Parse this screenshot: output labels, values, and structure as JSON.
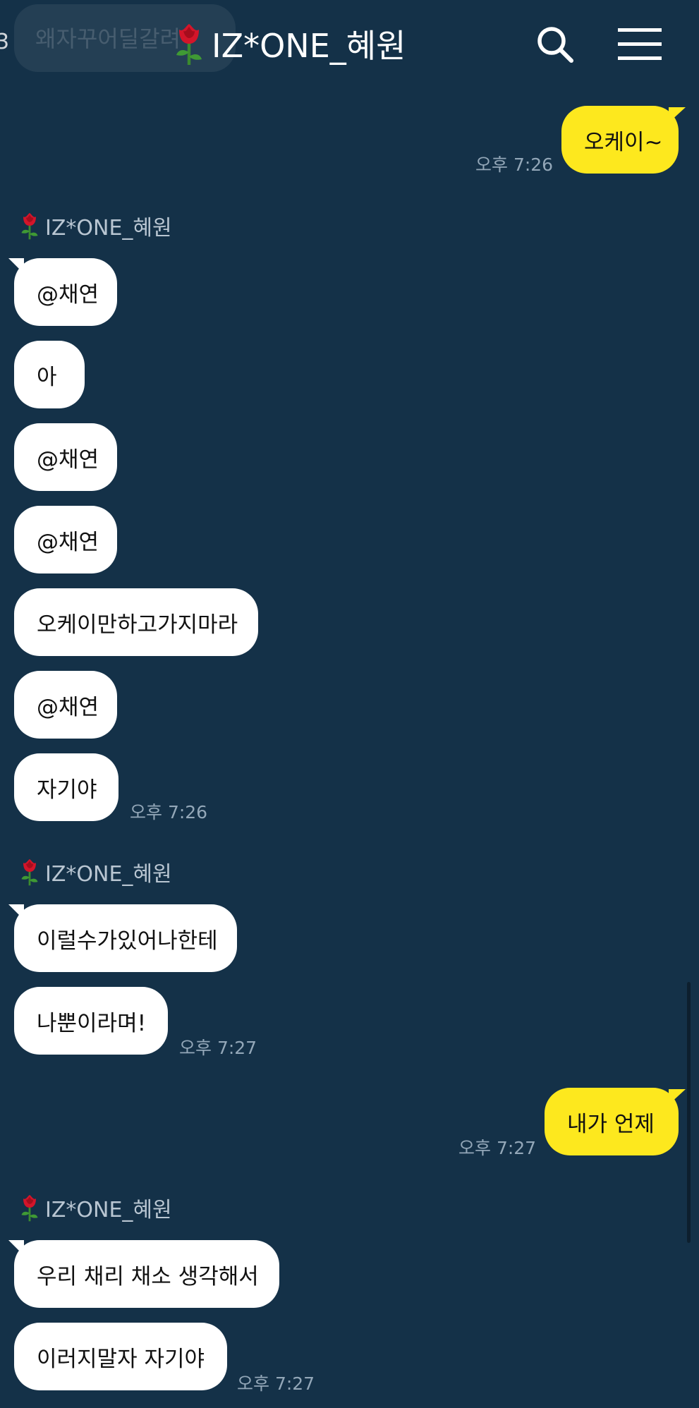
{
  "header": {
    "ghost_text": "왜자꾸어딜갈려",
    "left_edge_glyph": "3",
    "title": "IZ*ONE_혜원"
  },
  "messages": [
    {
      "id": "m1",
      "side": "right",
      "text": "오케이~",
      "time": "오후 7:26"
    },
    {
      "id": "s1",
      "type": "sender",
      "name": "IZ*ONE_혜원"
    },
    {
      "id": "m2",
      "side": "left",
      "text": "@채연"
    },
    {
      "id": "m3",
      "side": "left",
      "text": "아"
    },
    {
      "id": "m4",
      "side": "left",
      "text": "@채연"
    },
    {
      "id": "m5",
      "side": "left",
      "text": "@채연"
    },
    {
      "id": "m6",
      "side": "left",
      "text": "오케이만하고가지마라"
    },
    {
      "id": "m7",
      "side": "left",
      "text": "@채연"
    },
    {
      "id": "m8",
      "side": "left",
      "text": "자기야",
      "time": "오후 7:26"
    },
    {
      "id": "s2",
      "type": "sender",
      "name": "IZ*ONE_혜원"
    },
    {
      "id": "m9",
      "side": "left",
      "text": "이럴수가있어나한테"
    },
    {
      "id": "m10",
      "side": "left",
      "text": "나뿐이라며!",
      "time": "오후 7:27"
    },
    {
      "id": "m11",
      "side": "right",
      "text": "내가 언제",
      "time": "오후 7:27"
    },
    {
      "id": "s3",
      "type": "sender",
      "name": "IZ*ONE_혜원"
    },
    {
      "id": "m12",
      "side": "left",
      "text": "우리 채리 채소 생각해서"
    },
    {
      "id": "m13",
      "side": "left",
      "text": "이러지말자 자기야",
      "time": "오후 7:27"
    }
  ],
  "colors": {
    "background": "#143148",
    "my_bubble": "#fde81e",
    "their_bubble": "#ffffff",
    "time_text": "#93a7b8",
    "sender_text": "#b9c6d2"
  },
  "icons": {
    "search": "search-icon",
    "menu": "hamburger-menu-icon",
    "avatar": "rose-icon"
  }
}
